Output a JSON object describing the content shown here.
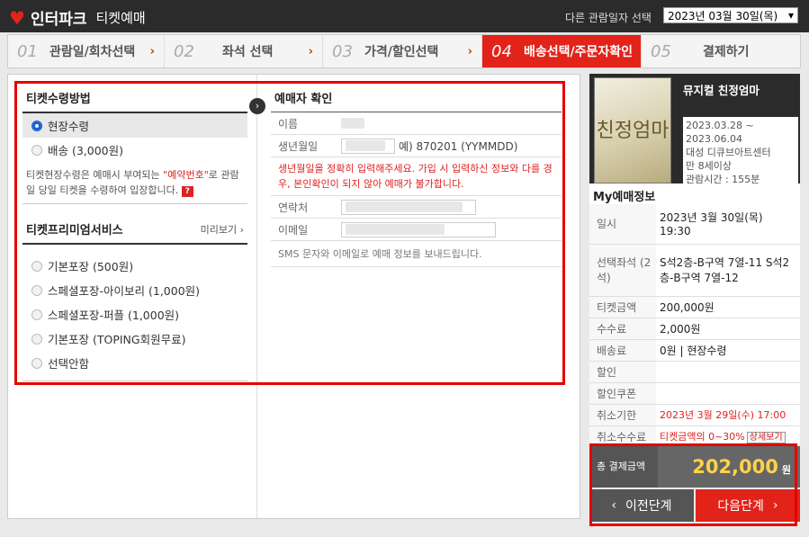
{
  "header": {
    "brand": "인터파크",
    "subtitle": "티켓예매",
    "date_label": "다른 관람일자 선택",
    "date_value": "2023년 03월 30일(목)"
  },
  "steps": [
    {
      "num": "01",
      "label": "관람일/회차선택"
    },
    {
      "num": "02",
      "label": "좌석 선택"
    },
    {
      "num": "03",
      "label": "가격/할인선택"
    },
    {
      "num": "04",
      "label": "배송선택/주문자확인"
    },
    {
      "num": "05",
      "label": "결제하기"
    }
  ],
  "receipt": {
    "title": "티켓수령방법",
    "options": [
      "현장수령",
      "배송 (3,000원)"
    ],
    "note_pre": "티켓현장수령은 예매시 부여되는 ",
    "note_hl": "\"예약번호\"",
    "note_post": "로 관람일 당일 티켓을 수령하여 입장합니다."
  },
  "premium": {
    "title": "티켓프리미엄서비스",
    "preview": "미리보기 ›",
    "options": [
      "기본포장 (500원)",
      "스페셜포장-아이보리 (1,000원)",
      "스페셜포장-퍼플 (1,000원)",
      "기본포장 (TOPING회원무료)",
      "선택안함"
    ]
  },
  "booker": {
    "title": "예매자 확인",
    "name_label": "이름",
    "birth_label": "생년월일",
    "birth_value": "예) 870201 (YYMMDD)",
    "warning": "생년월일을 정확히 입력해주세요. 가입 시 입력하신 정보와 다를 경우, 본인확인이 되지 않아 예매가 불가합니다.",
    "phone_label": "연락처",
    "email_label": "이메일",
    "sms_note": "SMS 문자와 이메일로 예매 정보를 보내드립니다."
  },
  "show": {
    "title": "뮤지컬 친정엄마",
    "poster_text": "친정엄마",
    "period": "2023.03.28 ~ 2023.06.04",
    "venue": "대성 디큐브아트센터",
    "age": "만 8세이상",
    "runtime": "관람시간 : 155분"
  },
  "myinfo": {
    "title": "My예매정보",
    "rows": [
      {
        "k": "일시",
        "v": "2023년 3월 30일(목) 19:30"
      },
      {
        "k": "선택좌석 (2석)",
        "v": "S석2층-B구역 7열-11 S석2층-B구역 7열-12"
      },
      {
        "k": "티켓금액",
        "v": "200,000원"
      },
      {
        "k": "수수료",
        "v": "2,000원"
      },
      {
        "k": "배송료",
        "v": "0원 | 현장수령"
      },
      {
        "k": "할인",
        "v": ""
      },
      {
        "k": "할인쿠폰",
        "v": ""
      },
      {
        "k": "취소기한",
        "v": "2023년 3월 29일(수) 17:00"
      },
      {
        "k": "취소수수료",
        "v": "티켓금액의 0~30%"
      }
    ],
    "detail_btn": "상세보기",
    "total_label": "총 결제금액",
    "total_value": "202,000",
    "total_unit": "원"
  },
  "nav": {
    "prev": "이전단계",
    "next": "다음단계"
  }
}
